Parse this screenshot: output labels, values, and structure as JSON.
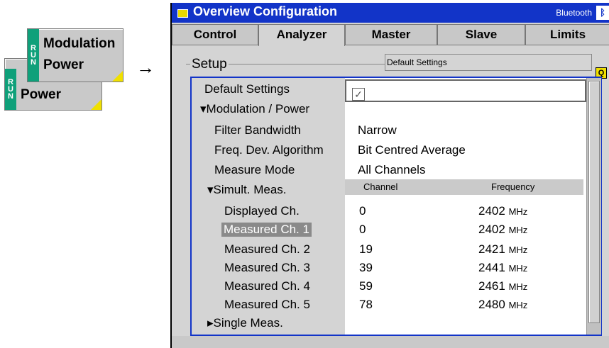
{
  "run_buttons": [
    {
      "run_letters": [
        "R",
        "U",
        "N"
      ],
      "label": "Power"
    },
    {
      "run_letters": [
        "R",
        "U",
        "N"
      ],
      "label_line1": "Modulation",
      "label_line2": "Power"
    }
  ],
  "arrow": "→",
  "window": {
    "title": "Overview Configuration",
    "mode": "Bluetooth",
    "bt_symbol": "ᛒ"
  },
  "tabs": [
    "Control",
    "Analyzer",
    "Master",
    "Slave",
    "Limits"
  ],
  "active_tab": "Analyzer",
  "setup": {
    "label": "Setup",
    "default_box": "Default Settings",
    "q_icon": "Q"
  },
  "tree": {
    "default_settings": {
      "label": "Default Settings",
      "value": "✓"
    },
    "mod_power": "▾Modulation / Power",
    "filter_bw": {
      "label": "Filter Bandwidth",
      "value": "Narrow"
    },
    "freq_dev": {
      "label": "Freq. Dev. Algorithm",
      "value": "Bit Centred Average"
    },
    "measure_mode": {
      "label": "Measure Mode",
      "value": "All Channels"
    },
    "simult_meas": "▾Simult. Meas.",
    "table_header": {
      "channel": "Channel",
      "frequency": "Frequency"
    },
    "channels": [
      {
        "label": "Displayed Ch.",
        "channel": "0",
        "freq": "2402",
        "unit": "MHz"
      },
      {
        "label": "Measured Ch. 1",
        "channel": "0",
        "freq": "2402",
        "unit": "MHz"
      },
      {
        "label": "Measured Ch. 2",
        "channel": "19",
        "freq": "2421",
        "unit": "MHz"
      },
      {
        "label": "Measured Ch. 3",
        "channel": "39",
        "freq": "2441",
        "unit": "MHz"
      },
      {
        "label": "Measured Ch. 4",
        "channel": "59",
        "freq": "2461",
        "unit": "MHz"
      },
      {
        "label": "Measured Ch. 5",
        "channel": "78",
        "freq": "2480",
        "unit": "MHz"
      }
    ],
    "single_meas": "▸Single Meas."
  },
  "colors": {
    "title_bar": "#1234c8",
    "run_strip": "#0fa07a",
    "corner_yellow": "#f0e000"
  }
}
